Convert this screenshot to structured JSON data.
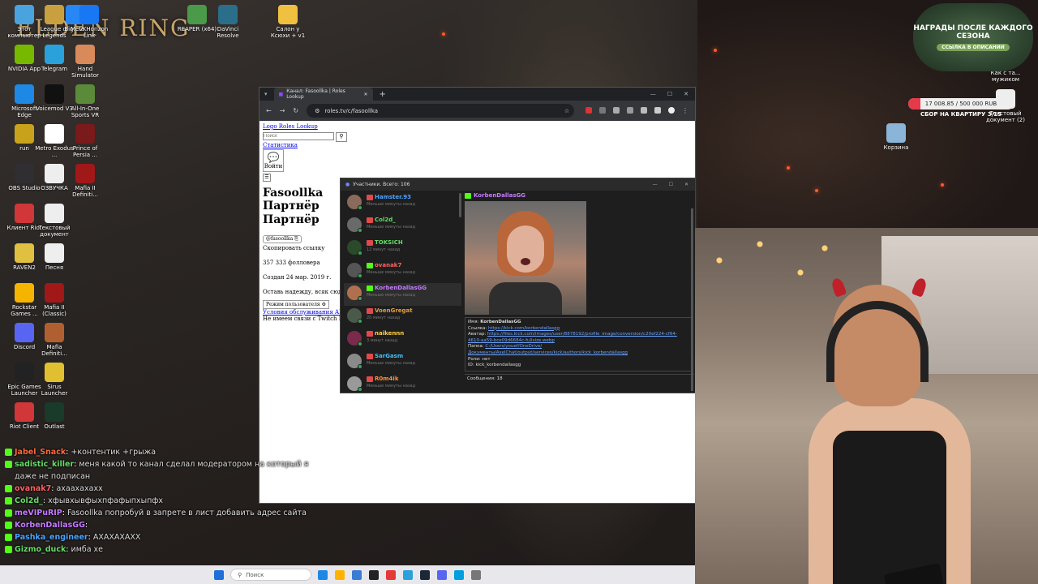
{
  "desktop": {
    "game_title": "ELDEN RING",
    "icons": [
      {
        "label": "Этот компьютер",
        "color": "#4aa3df"
      },
      {
        "label": "League of Legends",
        "color": "#c8a040"
      },
      {
        "label": "Big...VK",
        "color": "#2787f5"
      },
      {
        "label": "Meta Horizon Link",
        "color": "#1877f2"
      },
      {
        "label": "REAPER (x64)",
        "color": "#4a9a4a"
      },
      {
        "label": "DaVinci Resolve",
        "color": "#2a6e8a"
      },
      {
        "label": "Салон у Ксюхи + v1",
        "color": "#f0c040"
      },
      {
        "label": "NVIDIA App",
        "color": "#76b900"
      },
      {
        "label": "Telegram",
        "color": "#2aa1da"
      },
      {
        "label": "Hand Simulator",
        "color": "#d88a5a"
      },
      {
        "label": "Microsoft Edge",
        "color": "#1e88e5"
      },
      {
        "label": "Voicemod V3",
        "color": "#111111"
      },
      {
        "label": "All-In-One Sports VR",
        "color": "#5a8a3a"
      },
      {
        "label": "run",
        "color": "#c9a21c"
      },
      {
        "label": "Metro Exodus ...",
        "color": "#ffffff"
      },
      {
        "label": "Prince of Persia ...",
        "color": "#7a1a1a"
      },
      {
        "label": "OBS Studio",
        "color": "#302e31"
      },
      {
        "label": "ОЗВУЧКА",
        "color": "#eeeeee"
      },
      {
        "label": "Mafia II Definiti...",
        "color": "#a01818"
      },
      {
        "label": "Клиент Riot",
        "color": "#d13639"
      },
      {
        "label": "Текстовый документ",
        "color": "#eeeeee"
      },
      {
        "label": "RAVEN2",
        "color": "#e0c040"
      },
      {
        "label": "Песня",
        "color": "#eeeeee"
      },
      {
        "label": "Rockstar Games ...",
        "color": "#f4b400"
      },
      {
        "label": "Mafia II (Classic)",
        "color": "#a01818"
      },
      {
        "label": "Discord",
        "color": "#5865f2"
      },
      {
        "label": "Mafia Definiti...",
        "color": "#b06030"
      },
      {
        "label": "Epic Games Launcher",
        "color": "#222222"
      },
      {
        "label": "Sirus Launcher",
        "color": "#e0c030"
      },
      {
        "label": "Riot Client",
        "color": "#d13639"
      },
      {
        "label": "Outlast",
        "color": "#1a3a2a"
      },
      {
        "label": "Корзина",
        "color": "#8ab4d8"
      },
      {
        "label": "Как с та... мужиком",
        "color": "#eeeeee"
      },
      {
        "label": "Текстовый документ (2)",
        "color": "#eeeeee"
      }
    ]
  },
  "browser": {
    "tab_title": "Канал: Fasoollka | Roles Lookup",
    "address": "roles.tv/c/fasoollka",
    "page": {
      "logo_link": "Logo Roles Lookup",
      "search_placeholder": "Поиск",
      "stats_link": "Статистика",
      "twitch_label": "Войти",
      "channel_name": "Fasoollka",
      "partner_img_alt": "Партнёр",
      "partner_label": "Партнёр",
      "handle": "@fasoollka",
      "copy_link": "Скопировать ссылку",
      "followers": "357 333 фолловера",
      "created": "Создан 24 мар. 2019 г.",
      "hope": "Оставь надежду, всяк сюда в...",
      "user_mode_btn": "Режим пользователя",
      "terms_link": "Условия обслуживания API",
      "disclaimer": "Не имеем связи с Twitch Int..."
    }
  },
  "participants": {
    "title": "Участники. Всего: 106",
    "items": [
      {
        "name": "Hamster.93",
        "sub": "Меньше минуты назад",
        "color": "#4aa3ff",
        "avatar": "#8a6a5a"
      },
      {
        "name": "Col2d_",
        "sub": "Меньше минуты назад",
        "color": "#66dd66",
        "avatar": "#6a6a6a"
      },
      {
        "name": "TOKSICH",
        "sub": "12 минут назад",
        "color": "#66dd66",
        "avatar": "#2a4a2a"
      },
      {
        "name": "ovanak7",
        "sub": "Меньше минуты назад",
        "color": "#ff6060",
        "avatar": "#555555"
      },
      {
        "name": "KorbenDallasGG",
        "sub": "Меньше минуты назад",
        "color": "#c57bff",
        "avatar": "#b07050"
      },
      {
        "name": "VoenGregat",
        "sub": "20 минут назад",
        "color": "#e0a040",
        "avatar": "#4a5a4a"
      },
      {
        "name": "naikennn",
        "sub": "3 минут назад",
        "color": "#ffd040",
        "avatar": "#7a2a4a"
      },
      {
        "name": "SarGasm",
        "sub": "Меньше минуты назад",
        "color": "#40c0ff",
        "avatar": "#8a8a8a"
      },
      {
        "name": "R0m4ik",
        "sub": "Меньше минуты назад",
        "color": "#ff9040",
        "avatar": "#999999"
      }
    ],
    "detail": {
      "name": "KorbenDallasGG",
      "name_label": "Имя:",
      "link_label": "Ссылка:",
      "link": "https://kick.com/korbendallasgg",
      "avatar_label": "Аватар:",
      "avatar_url": "https://files.kick.com/images/user/8878192/profile_image/conversion/c20ef224-cf64-4610-aa59-bce09d6684c-fullsize.webp",
      "folder_label": "Папка:",
      "folder": "C:/Users/youef/OneDrive/Документы/AxelChat/output/services/kick/authors/kick_korbendallasgg",
      "roles": "Роли: нет",
      "id": "ID: kick_korbendallasgg",
      "messages": "Сообщения: 18"
    }
  },
  "overlay": {
    "reward_title": "НАГРАДЫ ПОСЛЕ КАЖДОГО СЕЗОНА",
    "reward_sub": "ССЫЛКА В ОПИСАНИИ",
    "goal_text": "17 008.85 / 500 000 RUB",
    "goal_label": "СБОР НА КВАРТИРУ 3/15",
    "goal_progress": 0.034
  },
  "chat": [
    {
      "user": "Jabel_Snack",
      "msg": "+контентик +грыжа",
      "ucolor": "#ff6a3a"
    },
    {
      "user": "sadistic_killer",
      "msg": "меня какой то канал сделал модератором на который я даже не подписан",
      "ucolor": "#66dd66"
    },
    {
      "user": "ovanak7",
      "msg": "ахаахахахх",
      "ucolor": "#ff6060"
    },
    {
      "user": "Col2d_",
      "msg": "хфывхывфыхпфафыпхыпфх",
      "ucolor": "#66dd66"
    },
    {
      "user": "meVIPuRIP",
      "msg": "Fasoollka попробуй в запрете в лист добавить адрес сайта",
      "ucolor": "#c57bff"
    },
    {
      "user": "KorbenDallasGG",
      "msg": "",
      "ucolor": "#c57bff"
    },
    {
      "user": "Pashka_engineer",
      "msg": "АХАХАХАХХ",
      "ucolor": "#4aa3ff"
    },
    {
      "user": "Gizmo_duck",
      "msg": "имба хе",
      "ucolor": "#66dd66"
    }
  ],
  "taskbar": {
    "search": "Поиск",
    "icons": [
      "#1e88e5",
      "#ffb300",
      "#3a7bd5",
      "#222222",
      "#e53935",
      "#2aa1da",
      "#1b2838",
      "#5865f2",
      "#00a0e0",
      "#777777"
    ]
  }
}
